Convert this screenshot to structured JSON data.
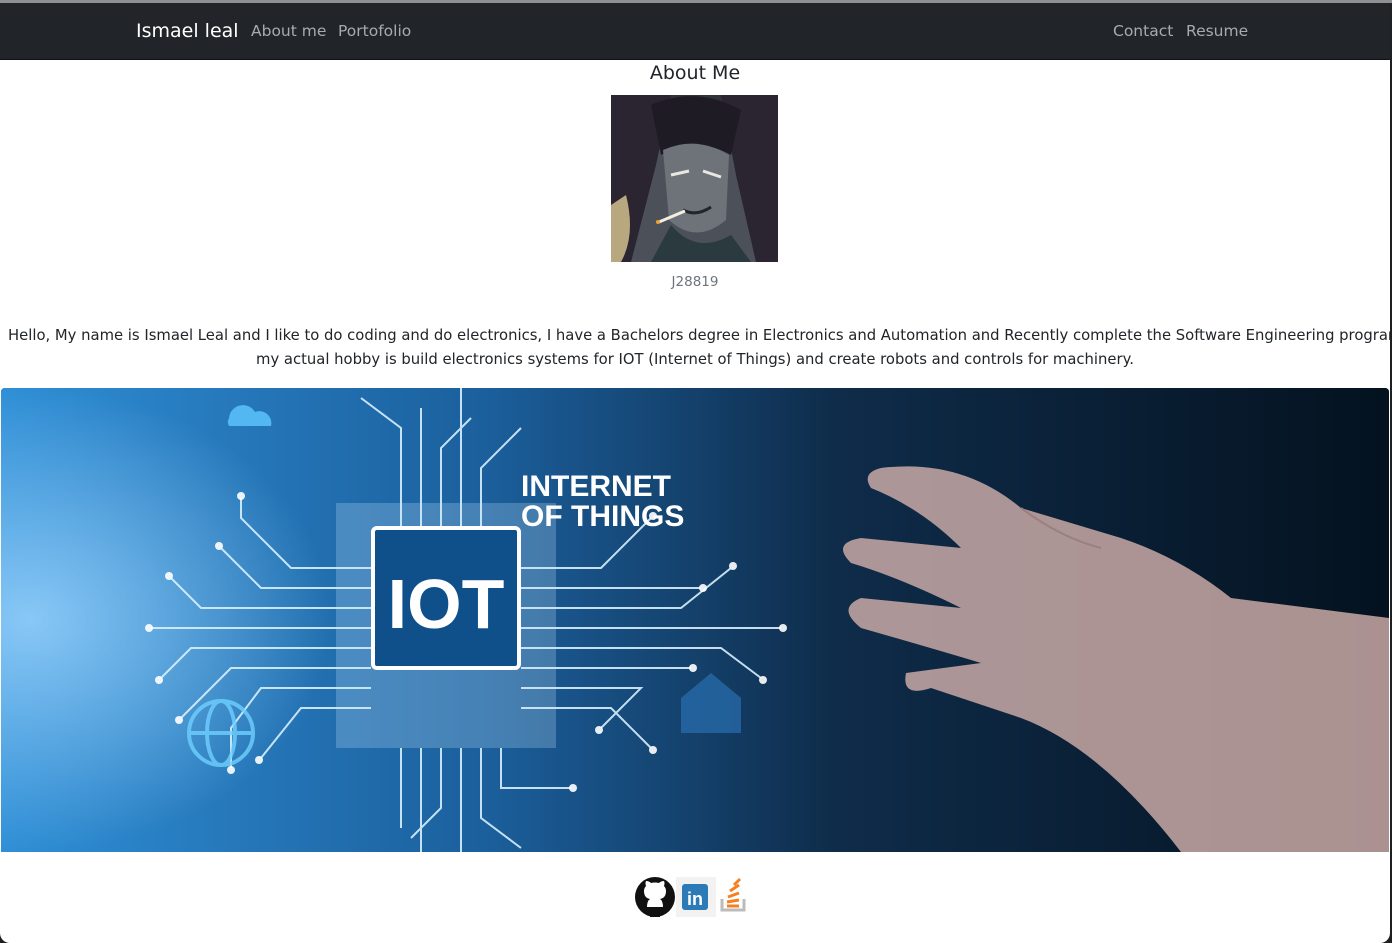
{
  "navbar": {
    "brand": "Ismael leal",
    "left_links": [
      "About me",
      "Portofolio"
    ],
    "right_links": [
      "Contact",
      "Resume"
    ]
  },
  "about": {
    "title": "About Me",
    "avatar_caption": "J28819",
    "bio_lines": [
      "Hello, My name is Ismael Leal and I like to do coding and do electronics, I have a Bachelors degree in Electronics and Automation and Recently complete the Software Engineering program.",
      "my actual hobby is build electronics systems for IOT (Internet of Things) and create robots and controls for machinery."
    ]
  },
  "banner": {
    "chip_label": "IOT",
    "headline_line1": "INTERNET",
    "headline_line2": "OF THINGS"
  },
  "social": {
    "icons": [
      "github-icon",
      "linkedin-icon",
      "stackoverflow-icon"
    ],
    "linkedin_text": "in"
  },
  "colors": {
    "navbar_bg": "#212529",
    "nav_link": "#a8abae",
    "brand": "#ffffff",
    "text": "#212529",
    "muted": "#6c757d",
    "stackoverflow_orange": "#f48024"
  }
}
